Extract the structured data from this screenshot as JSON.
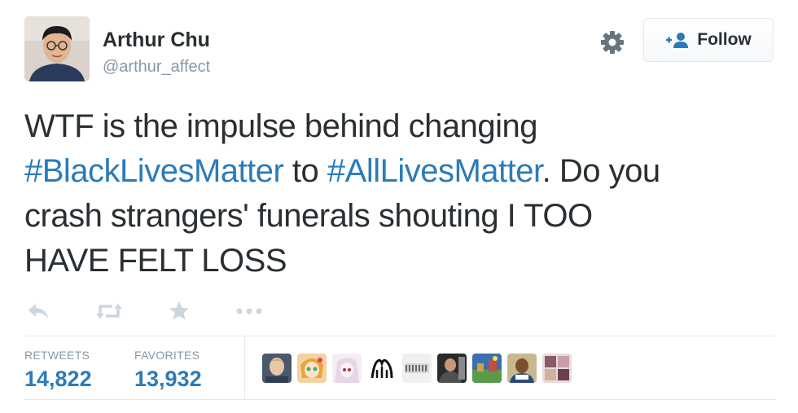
{
  "tweet": {
    "author": {
      "display_name": "Arthur Chu",
      "username": "@arthur_affect",
      "avatar_icon": "profile-photo"
    },
    "follow_label": "Follow",
    "text_lines": [
      [
        "WTF is the impulse behind changing"
      ],
      [
        "#BlackLivesMatter",
        " to ",
        "#AllLivesMatter",
        ". Do you"
      ],
      [
        "crash strangers' funerals shouting I TOO"
      ],
      [
        "HAVE FELT LOSS"
      ]
    ],
    "actions": [
      "reply-icon",
      "retweet-icon",
      "favorite-icon",
      "more-icon"
    ],
    "stats": {
      "retweets_label": "RETWEETS",
      "retweets_value": "14,822",
      "favorites_label": "FAVORITES",
      "favorites_value": "13,932"
    },
    "favorited_by_avatar_count": 9
  },
  "colors": {
    "text": "#292f33",
    "muted": "#8899a6",
    "link": "#2b7bb9",
    "border": "#e1e8ed",
    "icon": "#ccd6dd"
  }
}
